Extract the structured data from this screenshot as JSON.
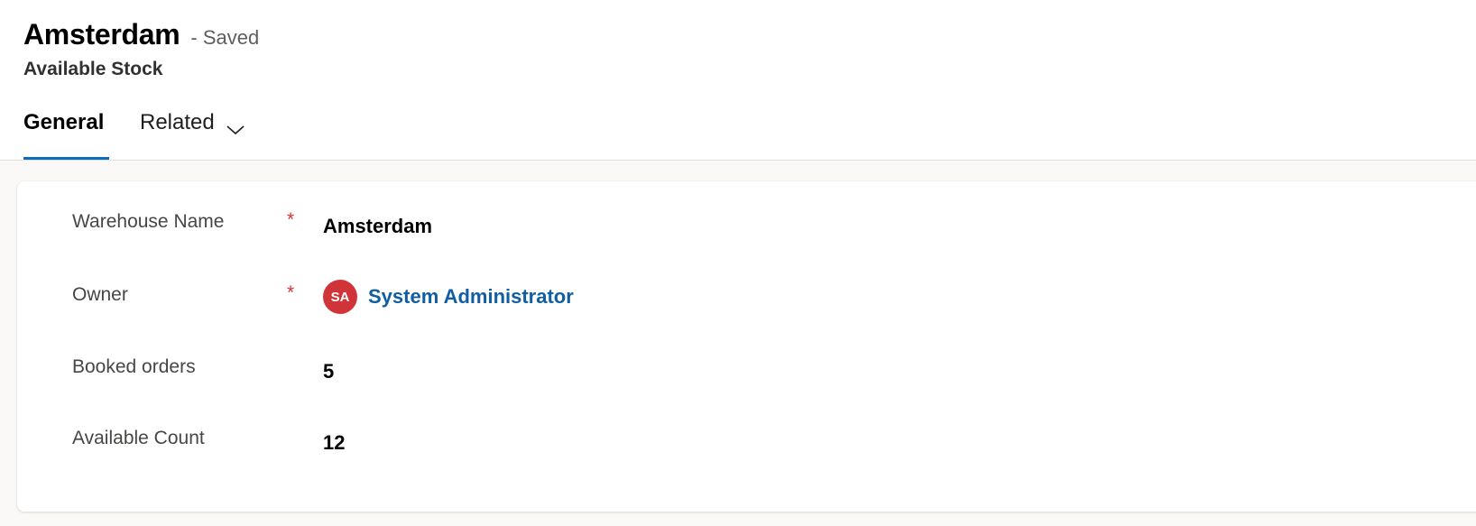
{
  "record": {
    "title": "Amsterdam",
    "save_status": "- Saved",
    "entity_name": "Available Stock"
  },
  "tabs": [
    {
      "label": "General",
      "selected": true
    },
    {
      "label": "Related",
      "selected": false,
      "icon": "chevron-down-icon"
    }
  ],
  "fields": {
    "warehouse_name": {
      "label": "Warehouse Name",
      "required_marker": "*",
      "value": "Amsterdam"
    },
    "owner": {
      "label": "Owner",
      "required_marker": "*",
      "avatar_initials": "SA",
      "value": "System Administrator"
    },
    "booked_orders": {
      "label": "Booked orders",
      "value": "5"
    },
    "available_count": {
      "label": "Available Count",
      "value": "12"
    }
  },
  "colors": {
    "accent": "#0f6cbd",
    "required": "#d13438",
    "avatar_bg": "#d13438",
    "link": "#115ea3"
  }
}
